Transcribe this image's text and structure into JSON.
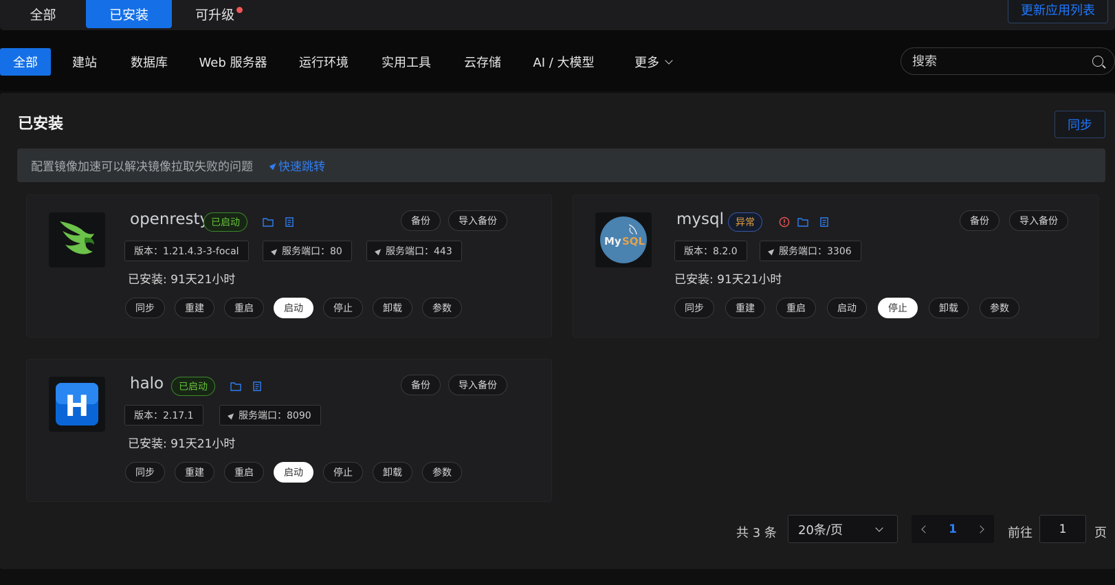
{
  "top_tabs": [
    {
      "label": "全部",
      "active": false
    },
    {
      "label": "已安装",
      "active": true
    },
    {
      "label": "可升级",
      "active": false,
      "has_dot": true
    }
  ],
  "update_list_button": "更新应用列表",
  "categories": [
    {
      "label": "全部",
      "active": true
    },
    {
      "label": "建站"
    },
    {
      "label": "数据库"
    },
    {
      "label": "Web 服务器"
    },
    {
      "label": "运行环境"
    },
    {
      "label": "实用工具"
    },
    {
      "label": "云存储"
    },
    {
      "label": "AI / 大模型"
    },
    {
      "label": "更多"
    }
  ],
  "search": {
    "placeholder": "搜索",
    "icon": "search-icon"
  },
  "panel": {
    "title": "已安装",
    "sync_button": "同步",
    "notice_text": "配置镜像加速可以解决镜像拉取失败的问题",
    "notice_link": "快速跳转"
  },
  "apps": [
    {
      "name": "openresty",
      "status": "已启动",
      "status_type": "ok",
      "backup": "备份",
      "import_backup": "导入备份",
      "version": "版本：1.21.4.3-3-focal",
      "ports": [
        "服务端口：80",
        "服务端口：443"
      ],
      "installed": "已安装:   91天21小时",
      "actions": [
        "同步",
        "重建",
        "重启",
        "启动",
        "停止",
        "卸载",
        "参数"
      ],
      "highlight_action": "启动"
    },
    {
      "name": "mysql",
      "status": "异常",
      "status_type": "error",
      "backup": "备份",
      "import_backup": "导入备份",
      "version": "版本：8.2.0",
      "ports": [
        "服务端口：3306"
      ],
      "installed": "已安装:   91天21小时",
      "actions": [
        "同步",
        "重建",
        "重启",
        "启动",
        "停止",
        "卸载",
        "参数"
      ],
      "highlight_action": "停止"
    },
    {
      "name": "halo",
      "status": "已启动",
      "status_type": "ok",
      "backup": "备份",
      "import_backup": "导入备份",
      "version": "版本：2.17.1",
      "ports": [
        "服务端口：8090"
      ],
      "installed": "已安装:   91天21小时",
      "actions": [
        "同步",
        "重建",
        "重启",
        "启动",
        "停止",
        "卸载",
        "参数"
      ],
      "highlight_action": "启动"
    }
  ],
  "pagination": {
    "total": "共 3 条",
    "page_size": "20条/页",
    "current_page": "1",
    "goto_label": "前往",
    "goto_value": "1",
    "page_unit": "页"
  },
  "colors": {
    "accent": "#1570e7",
    "ok": "#67c23a",
    "warn": "#e6a23c",
    "error": "#f05656"
  }
}
